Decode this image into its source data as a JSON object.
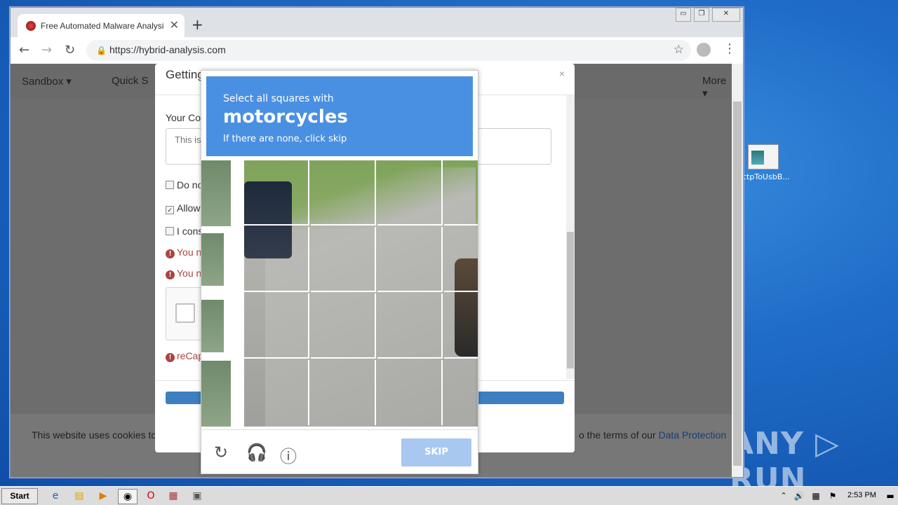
{
  "browser": {
    "tab_title": "Free Automated Malware Analysis S",
    "tab_close": "✕",
    "new_tab": "+",
    "url": "https://hybrid-analysis.com",
    "window_controls": [
      "▭",
      "❐",
      "✕"
    ],
    "nav": {
      "back": "←",
      "forward": "→",
      "reload": "↻",
      "lock": "🔒",
      "star": "☆",
      "menu": "⋮"
    }
  },
  "site": {
    "nav_items": [
      "Sandbox ▾",
      "Quick S",
      "More ▾"
    ],
    "cookie_left": "This website uses cookies to",
    "cookie_right": "o the terms of our ",
    "cookie_link": "Data Protection"
  },
  "modal": {
    "title": "Getting Things Read",
    "close": "×",
    "comment_label": "Your Cor",
    "comment_placeholder": "This is",
    "checkboxes": [
      {
        "label": "Do no",
        "checked": false
      },
      {
        "label": "Allow",
        "checked": true
      },
      {
        "label": "I cons",
        "checked": false
      }
    ],
    "errors": [
      "You n",
      "You n"
    ],
    "recaptcha_error": "reCap"
  },
  "captcha": {
    "instruction_line1": "Select all squares with",
    "target": "motorcycles",
    "instruction_line2": "If there are none, click skip",
    "skip_label": "SKIP",
    "icons": [
      "reload-icon",
      "headphones-icon",
      "info-icon"
    ]
  },
  "desktop": {
    "icon_label": "ctpToUsbB...",
    "watermark": "ANY ▷ RUN"
  },
  "taskbar": {
    "start_label": "Start",
    "clock": "2:53 PM"
  },
  "colors": {
    "captcha_blue": "#4a90e2",
    "skip_disabled": "#a9c8f1",
    "error_red": "#a94442",
    "link_blue": "#163f7a"
  }
}
